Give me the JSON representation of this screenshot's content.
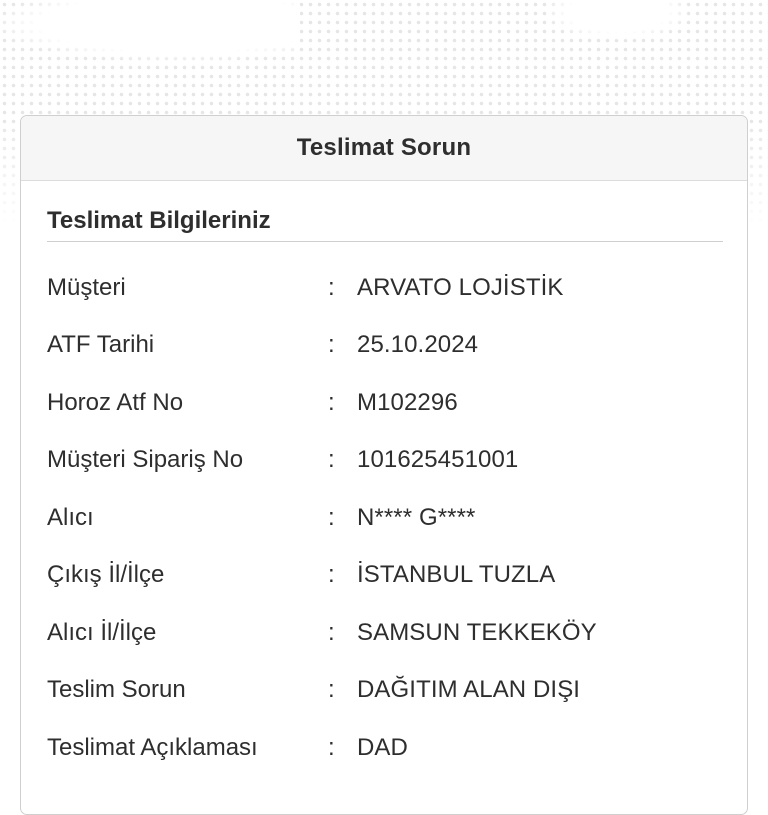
{
  "header": {
    "title": "Teslimat Sorun"
  },
  "section": {
    "title": "Teslimat Bilgileriniz"
  },
  "separator": ":",
  "rows": [
    {
      "label": "Müşteri",
      "value": "ARVATO LOJİSTİK"
    },
    {
      "label": "ATF Tarihi",
      "value": "25.10.2024"
    },
    {
      "label": "Horoz Atf No",
      "value": "M102296"
    },
    {
      "label": "Müşteri Sipariş No",
      "value": "101625451001"
    },
    {
      "label": "Alıcı",
      "value": "N**** G****"
    },
    {
      "label": "Çıkış İl/İlçe",
      "value": "İSTANBUL TUZLA"
    },
    {
      "label": "Alıcı İl/İlçe",
      "value": "SAMSUN TEKKEKÖY"
    },
    {
      "label": "Teslim Sorun",
      "value": "DAĞITIM ALAN DIŞI"
    },
    {
      "label": "Teslimat Açıklaması",
      "value": "DAD"
    }
  ],
  "colors": {
    "background_dots": "#e4e4e4",
    "card_border": "#cfcfcf",
    "header_bg": "#f6f6f6",
    "text": "#2e2e2e"
  }
}
